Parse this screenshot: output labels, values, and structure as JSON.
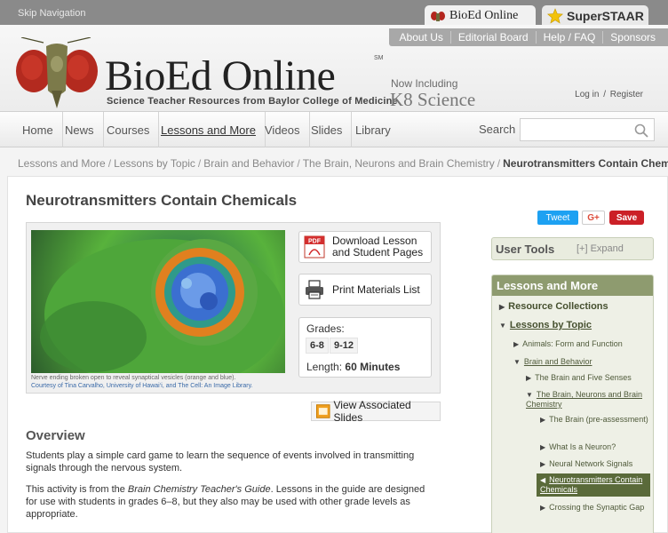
{
  "top": {
    "skip_nav": "Skip Navigation",
    "tab_bioed": "BioEd Online",
    "tab_superstaar": "SuperSTAAR"
  },
  "header": {
    "util_links": [
      "About Us",
      "Editorial Board",
      "Help / FAQ",
      "Sponsors"
    ],
    "logo_title": "BioEd Online",
    "logo_sm": "SM",
    "tagline": "Science Teacher Resources from Baylor College of Medicine",
    "now_including": "Now Including",
    "k8": "K8 Science",
    "login": "Log in",
    "login_sep": "/",
    "register": "Register"
  },
  "nav": {
    "items": [
      "Home",
      "News",
      "Courses",
      "Lessons and More",
      "Videos",
      "Slides",
      "Library"
    ],
    "active": "Lessons and More",
    "search_label": "Search",
    "search_placeholder": ""
  },
  "breadcrumb": {
    "items": [
      "Lessons and More",
      "Lessons by Topic",
      "Brain and Behavior",
      "The Brain, Neurons and Brain Chemistry"
    ],
    "current": "Neurotransmitters Contain Chemicals",
    "sep": "/"
  },
  "page": {
    "title": "Neurotransmitters Contain Chemicals",
    "share": {
      "tweet": "Tweet",
      "gplus": "G+",
      "save": "Save"
    },
    "image_caption": "Nerve ending broken open to reveal synaptical vesicles (orange and blue).",
    "image_credit": "Courtesy of Tina Carvalho, University of Hawai‘i, and The Cell: An Image Library.",
    "download_label": "Download Lesson and Student Pages",
    "download_line1": "Download Lesson",
    "download_line2": "and Student Pages",
    "pdf_icon_text": "PDF",
    "print_label": "Print Materials List",
    "grades_label": "Grades:",
    "grades": [
      "6-8",
      "9-12"
    ],
    "length_label": "Length:",
    "length_value": "60 Minutes",
    "view_slides": "View Associated Slides",
    "overview_heading": "Overview",
    "overview_p1": "Students play a simple card game to learn the sequence of events involved in transmitting signals through the nervous system.",
    "overview_p2_a": "This activity is from the ",
    "overview_p2_title": "Brain Chemistry Teacher's Guide",
    "overview_p2_b": ". Lessons in the guide are designed for use with students in grades 6–8, but they also may be used with other grade levels as appropriate."
  },
  "sidebar": {
    "user_tools": "User Tools",
    "expand": "[+] Expand",
    "lam_title": "Lessons and More",
    "tree": [
      {
        "label": "Resource Collections",
        "level": 1,
        "arrow": "▶"
      },
      {
        "label": "Lessons by Topic",
        "level": 1,
        "arrow": "▼"
      },
      {
        "label": "Animals: Form and Function",
        "level": 2,
        "arrow": "▶"
      },
      {
        "label": "Brain and Behavior",
        "level": 2,
        "arrow": "▼"
      },
      {
        "label": "The Brain and Five Senses",
        "level": 3,
        "arrow": "▶"
      },
      {
        "label": "The Brain, Neurons and Brain Chemistry",
        "level": 3,
        "arrow": "▼"
      },
      {
        "label": "The Brain (pre-assessment)",
        "level": 4,
        "arrow": "▶"
      },
      {
        "label": "What Is a Neuron?",
        "level": 4,
        "arrow": "▶"
      },
      {
        "label": "Neural Network Signals",
        "level": 4,
        "arrow": "▶"
      },
      {
        "label": "Neurotransmitters Contain Chemicals",
        "level": 4,
        "arrow": "◀"
      },
      {
        "label": "Crossing the Synaptic Gap",
        "level": 4,
        "arrow": "▶"
      }
    ]
  },
  "colors": {
    "accent_green": "#8e9b6f",
    "tweet_blue": "#1da1f2",
    "save_red": "#cb2027",
    "selected_tree": "#5a6a3a"
  }
}
